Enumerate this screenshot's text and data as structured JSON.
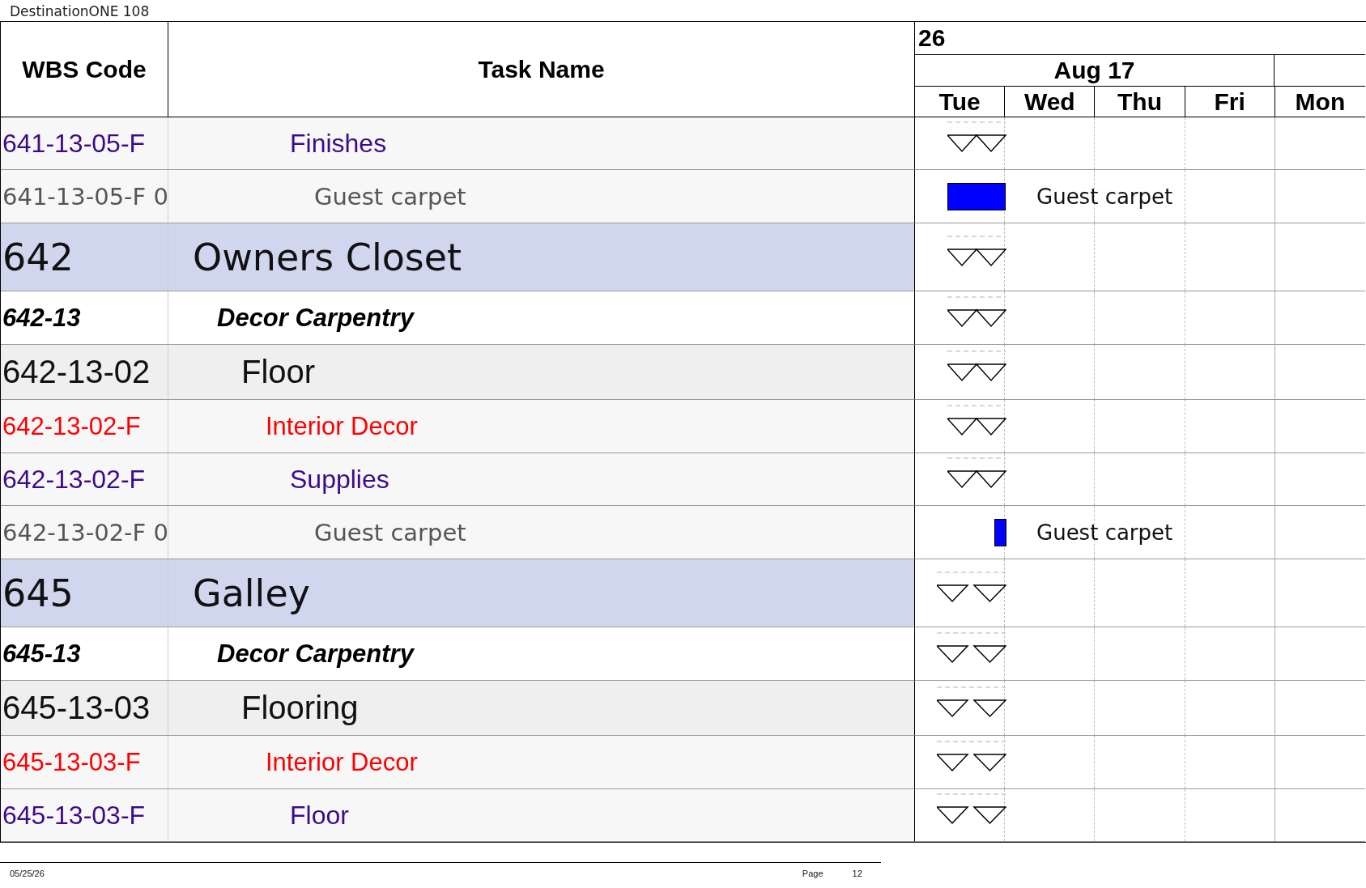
{
  "report_title": "DestinationONE 108",
  "columns": {
    "wbs": "WBS Code",
    "task": "Task Name"
  },
  "timescale": {
    "year": "26",
    "week": "Aug 17",
    "days": [
      {
        "label": "Tue"
      },
      {
        "label": "Wed"
      },
      {
        "label": "Thu"
      },
      {
        "label": "Fri"
      },
      {
        "label": "Mon"
      }
    ]
  },
  "rows": [
    {
      "kind": "subcategory",
      "wbs": "641-13-05-F",
      "task": "Finishes",
      "gantt": {
        "kind": "joined"
      }
    },
    {
      "kind": "task",
      "wbs": "641-13-05-F 0",
      "task": "Guest carpet",
      "gantt": {
        "kind": "wide",
        "label": "Guest carpet"
      }
    },
    {
      "kind": "group",
      "wbs": "642",
      "task": "Owners Closet",
      "gantt": {
        "kind": "joined"
      }
    },
    {
      "kind": "section",
      "wbs": "642-13",
      "task": "Decor Carpentry",
      "gantt": {
        "kind": "joined"
      }
    },
    {
      "kind": "subsection",
      "wbs": "642-13-02",
      "task": "Floor",
      "gantt": {
        "kind": "joined"
      }
    },
    {
      "kind": "category",
      "wbs": "642-13-02-F",
      "task": "Interior Decor",
      "gantt": {
        "kind": "joined"
      }
    },
    {
      "kind": "subcategory",
      "wbs": "642-13-02-F",
      "task": "Supplies",
      "gantt": {
        "kind": "joined"
      }
    },
    {
      "kind": "task",
      "wbs": "642-13-02-F 0",
      "task": "Guest carpet",
      "gantt": {
        "kind": "narrow",
        "label": "Guest carpet"
      }
    },
    {
      "kind": "group",
      "wbs": "645",
      "task": "Galley",
      "gantt": {
        "kind": "split"
      }
    },
    {
      "kind": "section",
      "wbs": "645-13",
      "task": "Decor Carpentry",
      "gantt": {
        "kind": "split"
      }
    },
    {
      "kind": "subsection",
      "wbs": "645-13-03",
      "task": "Flooring",
      "gantt": {
        "kind": "split"
      }
    },
    {
      "kind": "category",
      "wbs": "645-13-03-F",
      "task": "Interior Decor",
      "gantt": {
        "kind": "split"
      }
    },
    {
      "kind": "subcategory",
      "wbs": "645-13-03-F",
      "task": "Floor",
      "gantt": {
        "kind": "split"
      }
    }
  ],
  "footer": {
    "date": "05/25/26",
    "page_label": "Page",
    "page_number": "12"
  }
}
